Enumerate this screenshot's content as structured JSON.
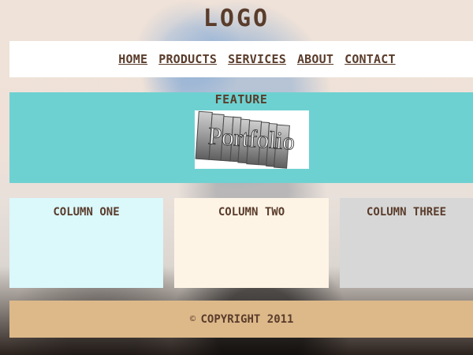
{
  "header": {
    "logo": "LOGO"
  },
  "nav": {
    "items": [
      {
        "label": "HOME"
      },
      {
        "label": "PRODUCTS"
      },
      {
        "label": "SERVICES"
      },
      {
        "label": "ABOUT"
      },
      {
        "label": "CONTACT"
      }
    ]
  },
  "feature": {
    "title": "FEATURE",
    "image_text": "Portfolio"
  },
  "columns": [
    {
      "title": "COLUMN ONE"
    },
    {
      "title": "COLUMN TWO"
    },
    {
      "title": "COLUMN THREE"
    }
  ],
  "footer": {
    "symbol": "©",
    "text": "COPYRIGHT 2011"
  },
  "colors": {
    "text_brown": "#5a3c2b",
    "nav_bg": "#ffffff",
    "feature_bg": "#6ed1d1",
    "col1_bg": "#dbf8fb",
    "col2_bg": "#fdf4e6",
    "col3_bg": "#d7d7d7",
    "footer_bg": "#ddb98a"
  }
}
